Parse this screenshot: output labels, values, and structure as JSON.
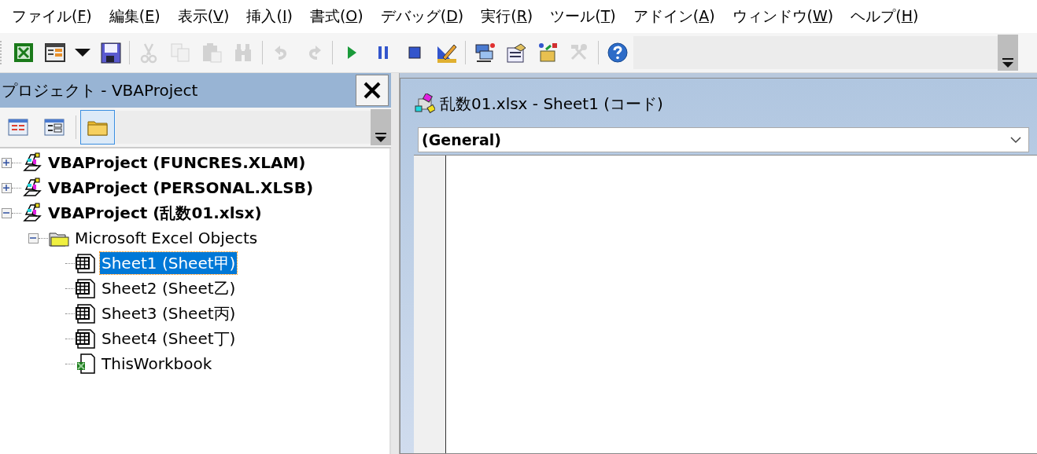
{
  "menu_bar": [
    {
      "before": "ファイル(",
      "key": "F",
      "after": ")"
    },
    {
      "before": "編集(",
      "key": "E",
      "after": ")"
    },
    {
      "before": "表示(",
      "key": "V",
      "after": ")"
    },
    {
      "before": "挿入(",
      "key": "I",
      "after": ")"
    },
    {
      "before": "書式(",
      "key": "O",
      "after": ")"
    },
    {
      "before": "デバッグ(",
      "key": "D",
      "after": ")"
    },
    {
      "before": "実行(",
      "key": "R",
      "after": ")"
    },
    {
      "before": "ツール(",
      "key": "T",
      "after": ")"
    },
    {
      "before": "アドイン(",
      "key": "A",
      "after": ")"
    },
    {
      "before": "ウィンドウ(",
      "key": "W",
      "after": ")"
    },
    {
      "before": "ヘルプ(",
      "key": "H",
      "after": ")"
    }
  ],
  "toolbar": [
    {
      "kind": "excel",
      "disabled": false
    },
    {
      "kind": "insert",
      "disabled": false
    },
    {
      "kind": "dropdown",
      "disabled": false
    },
    {
      "kind": "save",
      "disabled": false
    },
    {
      "kind": "sep"
    },
    {
      "kind": "cut",
      "disabled": true
    },
    {
      "kind": "copy",
      "disabled": true
    },
    {
      "kind": "paste",
      "disabled": true
    },
    {
      "kind": "find",
      "disabled": true
    },
    {
      "kind": "sep"
    },
    {
      "kind": "undo",
      "disabled": true
    },
    {
      "kind": "redo",
      "disabled": true
    },
    {
      "kind": "sep"
    },
    {
      "kind": "run",
      "disabled": false
    },
    {
      "kind": "pause",
      "disabled": false
    },
    {
      "kind": "stop",
      "disabled": false
    },
    {
      "kind": "design",
      "disabled": false
    },
    {
      "kind": "sep"
    },
    {
      "kind": "explorer",
      "disabled": false
    },
    {
      "kind": "properties",
      "disabled": false
    },
    {
      "kind": "objects",
      "disabled": false
    },
    {
      "kind": "tools",
      "disabled": true
    },
    {
      "kind": "sep"
    },
    {
      "kind": "help",
      "disabled": false
    }
  ],
  "project_panel": {
    "title": "プロジェクト - VBAProject",
    "toolbar": [
      {
        "kind": "view-code",
        "selected": false
      },
      {
        "kind": "view-object",
        "selected": false
      },
      {
        "kind": "toggle-folders",
        "selected": true
      }
    ],
    "tree": [
      {
        "label": "VBAProject (FUNCRES.XLAM)",
        "kind": "project",
        "expanded": false,
        "selected": false
      },
      {
        "label": "VBAProject (PERSONAL.XLSB)",
        "kind": "project",
        "expanded": false,
        "selected": false
      },
      {
        "label": "VBAProject (乱数01.xlsx)",
        "kind": "project",
        "expanded": true,
        "selected": false,
        "children": [
          {
            "label": "Microsoft Excel Objects",
            "kind": "folder",
            "expanded": true,
            "selected": false,
            "children": [
              {
                "label": "Sheet1 (Sheet甲)",
                "kind": "sheet",
                "selected": true
              },
              {
                "label": "Sheet2 (Sheet乙)",
                "kind": "sheet",
                "selected": false
              },
              {
                "label": "Sheet3 (Sheet丙)",
                "kind": "sheet",
                "selected": false
              },
              {
                "label": "Sheet4 (Sheet丁)",
                "kind": "sheet",
                "selected": false
              },
              {
                "label": "ThisWorkbook",
                "kind": "workbook",
                "selected": false
              }
            ]
          }
        ]
      }
    ]
  },
  "code_window": {
    "title": "乱数01.xlsx - Sheet1 (コード)",
    "object_dropdown": "(General)"
  }
}
